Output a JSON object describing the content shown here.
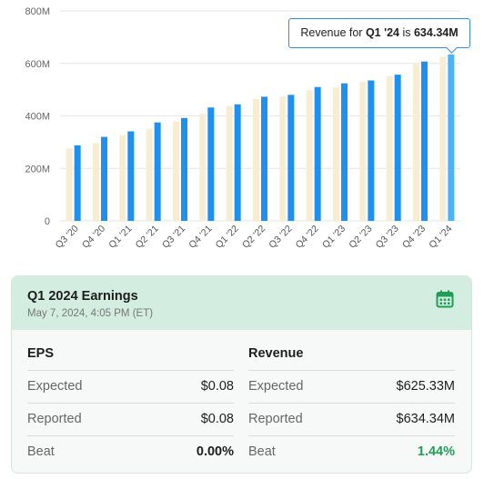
{
  "chart_data": {
    "type": "bar",
    "categories": [
      "Q3 '20",
      "Q4 '20",
      "Q1 '21",
      "Q2 '21",
      "Q3 '21",
      "Q4 '21",
      "Q1 '22",
      "Q2 '22",
      "Q3 '22",
      "Q4 '22",
      "Q1 '23",
      "Q2 '23",
      "Q3 '23",
      "Q4 '23",
      "Q1 '24"
    ],
    "series": [
      {
        "role": "expected",
        "values": [
          276,
          296,
          326,
          351,
          379,
          409,
          438,
          465,
          474,
          498,
          508,
          530,
          552,
          597,
          625.33
        ]
      },
      {
        "role": "actual",
        "values": [
          288,
          320,
          341,
          375,
          392,
          432,
          444,
          473,
          480,
          510,
          524,
          535,
          557,
          607,
          634.34
        ]
      }
    ],
    "ylim": [
      0,
      800
    ],
    "yticks": [
      0,
      200,
      400,
      600,
      800
    ],
    "ytick_labels": [
      "0",
      "200M",
      "400M",
      "600M",
      "800M"
    ],
    "grid": true,
    "colors": {
      "expected": "#f7edd2",
      "actual": "#1e90f0",
      "highlight": "#4db3f7"
    }
  },
  "tooltip": {
    "prefix": "Revenue for",
    "quarter": "Q1 '24",
    "middle": "is",
    "value": "634.34M"
  },
  "card": {
    "title": "Q1 2024 Earnings",
    "subtitle": "May 7, 2024, 4:05 PM (ET)",
    "icon": "calendar-icon",
    "eps": {
      "heading": "EPS",
      "rows": [
        {
          "label": "Expected",
          "value": "$0.08"
        },
        {
          "label": "Reported",
          "value": "$0.08"
        },
        {
          "label": "Beat",
          "value": "0.00%"
        }
      ]
    },
    "revenue": {
      "heading": "Revenue",
      "rows": [
        {
          "label": "Expected",
          "value": "$625.33M"
        },
        {
          "label": "Reported",
          "value": "$634.34M"
        },
        {
          "label": "Beat",
          "value": "1.44%"
        }
      ]
    }
  }
}
